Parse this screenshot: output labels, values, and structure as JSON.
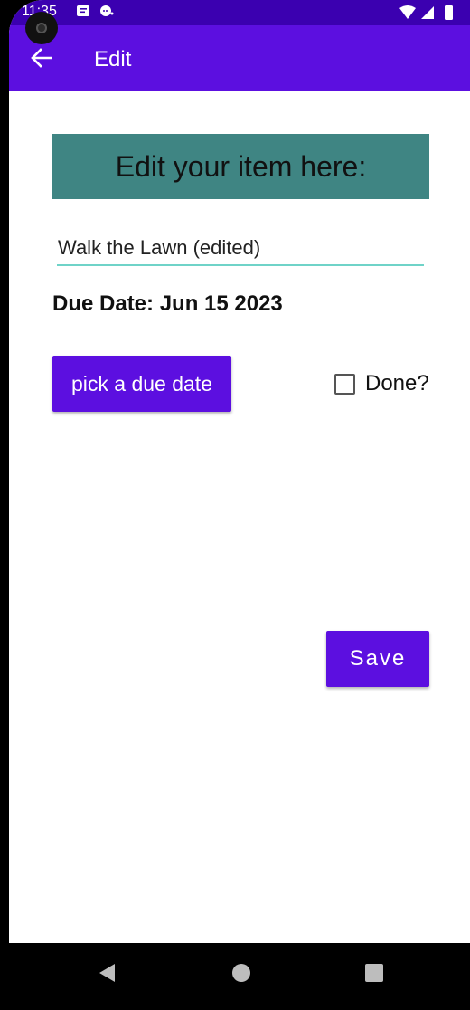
{
  "status_bar": {
    "time": "11:35",
    "icons": [
      "message-notification-icon",
      "chat-notification-icon",
      "wifi-icon",
      "signal-icon",
      "battery-icon"
    ]
  },
  "app_bar": {
    "title": "Edit",
    "back_icon": "arrow-left-icon",
    "color": "#5c0fe0"
  },
  "form": {
    "header": "Edit your item here:",
    "item_value": "Walk the Lawn (edited)",
    "due_date": "Due Date: Jun 15 2023",
    "pick_button": "pick a due date",
    "done_label": "Done?",
    "done_checked": false,
    "save_button": "Save"
  },
  "colors": {
    "accent": "#5c0fe0",
    "status_bar": "#3b00b0",
    "header_bg": "#3f8583",
    "input_underline": "#6fd3c8"
  },
  "nav_bar": {
    "icons": [
      "back-triangle-icon",
      "home-circle-icon",
      "recents-square-icon"
    ]
  }
}
